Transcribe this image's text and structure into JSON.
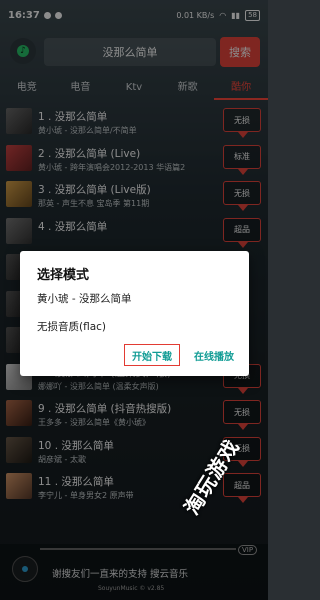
{
  "status_bar": {
    "time": "16:37",
    "speed": "0.01 KB/s",
    "battery": "58"
  },
  "search": {
    "query": "没那么简单",
    "button_label": "搜索"
  },
  "tabs": [
    {
      "label": "电竞"
    },
    {
      "label": "电音"
    },
    {
      "label": "Ktv"
    },
    {
      "label": "新歌"
    },
    {
      "label": "酷你"
    }
  ],
  "songs": [
    {
      "title": "1 . 没那么简单",
      "artist": "黄小琥 - 没那么简单/不简单",
      "quality": "无损"
    },
    {
      "title": "2 . 没那么简单 (Live)",
      "artist": "黄小琥 - 跨年演唱会2012-2013 华语篇2",
      "quality": "标准"
    },
    {
      "title": "3 . 没那么简单 (Live版)",
      "artist": "那英 - 声生不息 宝岛季 第11期",
      "quality": "无损"
    },
    {
      "title": "4 . 没那么简单",
      "artist": "",
      "quality": "超品"
    },
    {
      "title": "",
      "artist": "",
      "quality": ""
    },
    {
      "title": "",
      "artist": "",
      "quality": ""
    },
    {
      "title": "",
      "artist": "",
      "quality": ""
    },
    {
      "title": "8 . 没那么简单 (温柔女声版)",
      "artist": "娜娜吖 - 没那么简单 (温柔女声版)",
      "quality": "无损"
    },
    {
      "title": "9 . 没那么简单 (抖音热搜版)",
      "artist": "王多多 - 没那么简单《黄小琥》",
      "quality": "无损"
    },
    {
      "title": "10 . 没那么简单",
      "artist": "胡彦斌 - 太歌",
      "quality": "无损"
    },
    {
      "title": "11 . 没那么简单",
      "artist": "李宁儿 - 单身男女2 原声带",
      "quality": "超品"
    }
  ],
  "dialog": {
    "title": "选择模式",
    "song": "黄小琥 - 没那么简单",
    "quality": "无损音质(flac)",
    "download_label": "开始下载",
    "play_label": "在线播放"
  },
  "player": {
    "marquee": "谢搜友们一直来的支持 搜云音乐",
    "version": "SouyunMusic © v2.85",
    "vip": "VIP"
  },
  "watermark": "淘玩游戏",
  "colors": {
    "accent": "#e8453c",
    "dialog_button": "#119c95"
  }
}
